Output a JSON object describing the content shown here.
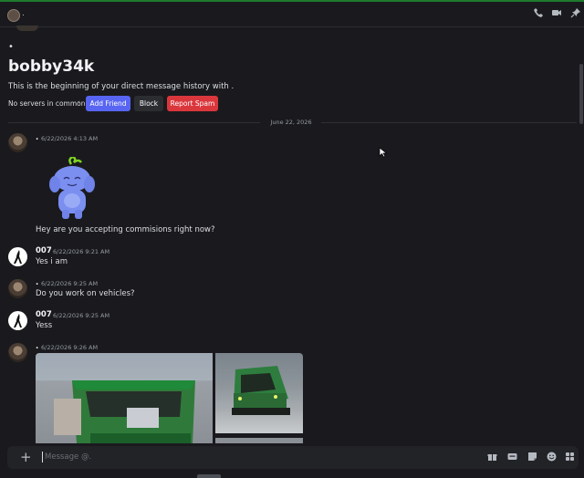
{
  "header": {
    "name": "."
  },
  "intro": {
    "bullet": "•",
    "title": "bobby34k",
    "text": "This is the beginning of your direct message history with .",
    "no_servers": "No servers in common",
    "sep": "•",
    "add_friend": "Add Friend",
    "block": "Block",
    "report_spam": "Report Spam"
  },
  "divider": {
    "date": "June 22, 2026"
  },
  "messages": [
    {
      "author": ".",
      "time": "6/22/2026 4:13 AM",
      "text": "Hey are you accepting commisions right now?"
    },
    {
      "author": "007",
      "time": "6/22/2026 9:21 AM",
      "text": "Yes i am"
    },
    {
      "author": ".",
      "time": "6/22/2026 9:25 AM",
      "text": "Do you work on vehicles?"
    },
    {
      "author": "007",
      "time": "6/22/2026 9:25 AM",
      "text": "Yess"
    },
    {
      "author": ".",
      "time": "6/22/2026 9:26 AM"
    }
  ],
  "composer": {
    "placeholder": "Message @."
  },
  "colors": {
    "accent": "#5865f2",
    "danger": "#da373c",
    "background": "#1a1a1e"
  }
}
